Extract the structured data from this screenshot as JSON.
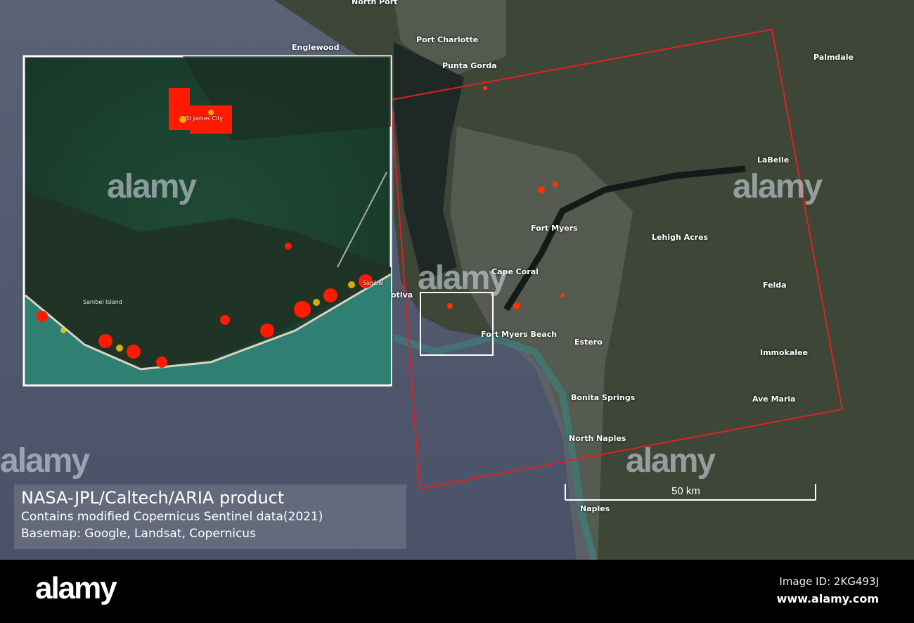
{
  "map": {
    "colors": {
      "sea": "#5c6478",
      "land": "#3c4536",
      "frame": "#e02020",
      "inset_border": "#ffffff",
      "damage_high": "#ff1a00",
      "damage_low": "#ffd000"
    },
    "places": [
      "North Port",
      "Port Charlotte",
      "Englewood",
      "Punta Gorda",
      "Palmdale",
      "LaBelle",
      "Fort Myers",
      "Lehigh Acres",
      "Cape Coral",
      "Felda",
      "otiva",
      "Fort Myers Beach",
      "Estero",
      "Immokalee",
      "Bonita Springs",
      "Ave Maria",
      "North Naples",
      "Naples"
    ],
    "inset_places": [
      "St James City",
      "Sanibel Island",
      "Sanibel"
    ],
    "scale_bar": "50 km"
  },
  "attribution": {
    "line1": "NASA-JPL/Caltech/ARIA product",
    "line2": "Contains modified Copernicus Sentinel data(2021)",
    "line3": "Basemap: Google, Landsat, Copernicus"
  },
  "watermark": {
    "logo": "alamy",
    "image_id": "Image ID: 2KG493J",
    "site": "www.alamy.com",
    "mark": "alamy"
  }
}
